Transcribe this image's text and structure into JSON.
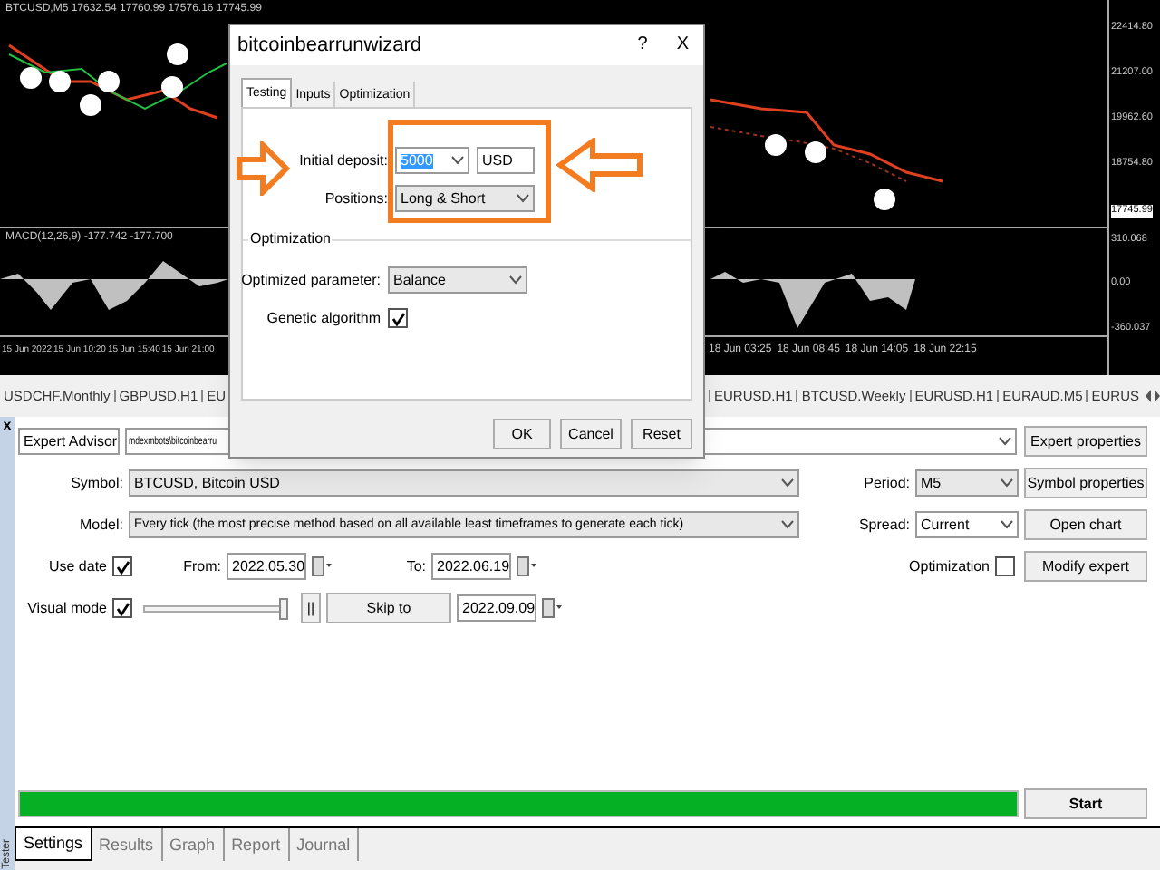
{
  "chart": {
    "header": "BTCUSD,M5 17632.54 17760.99 17576.16 17745.99",
    "macd_header": "MACD(12,26,9) -177.742 -177.700",
    "price_labels": [
      "22414.80",
      "21207.00",
      "19962.60",
      "18754.80"
    ],
    "current_price": "17745.99",
    "macd_labels": [
      "310.068",
      "0.00",
      "-360.037"
    ],
    "time_labels_left": [
      "15 Jun 2022",
      "15 Jun 10:20",
      "15 Jun 15:40",
      "15 Jun 21:00"
    ],
    "time_labels_right": [
      "18 Jun 03:25",
      "18 Jun 08:45",
      "18 Jun 14:05",
      "18 Jun 22:15"
    ]
  },
  "chart_tabs_left": [
    "USDCHF.Monthly",
    "GBPUSD.H1",
    "EU"
  ],
  "chart_tabs_right": [
    "EURUSD.H1",
    "BTCUSD.Weekly",
    "EURUSD.H1",
    "EURAUD.M5",
    "EURUS"
  ],
  "dialog": {
    "title": "bitcoinbearrunwizard",
    "help": "?",
    "close": "X",
    "tabs": [
      {
        "label": "Testing",
        "selected": true
      },
      {
        "label": "Inputs",
        "selected": false
      },
      {
        "label": "Optimization",
        "selected": false
      }
    ],
    "deposit_label": "Initial deposit:",
    "deposit": "5000",
    "currency": "USD",
    "positions_label": "Positions:",
    "positions": "Long & Short",
    "group_title": "Optimization",
    "param_label": "Optimized parameter:",
    "param": "Balance",
    "genetic_label": "Genetic algorithm",
    "genetic_checked": true,
    "buttons": [
      "OK",
      "Cancel",
      "Reset"
    ]
  },
  "tester": {
    "close": "x",
    "side_label": "Tester",
    "program_type": "Expert Advisor",
    "expert_path": "mdexmbots\\bitcoinbearru",
    "symbol_label": "Symbol:",
    "symbol": "BTCUSD, Bitcoin USD",
    "period_label": "Period:",
    "period": "M5",
    "model_label": "Model:",
    "model": "Every tick (the most precise method based on all available least timeframes to generate each tick)",
    "spread_label": "Spread:",
    "spread": "Current",
    "use_date_label": "Use date",
    "use_date_checked": true,
    "from_label": "From:",
    "from": "2022.05.30",
    "to_label": "To:",
    "to": "2022.06.19",
    "optimization_label": "Optimization",
    "optimization_checked": false,
    "visual_label": "Visual mode",
    "visual_checked": true,
    "speed": {
      "level": 1
    },
    "pause": "||",
    "skip_button": "Skip to",
    "skip_date": "2022.09.09",
    "buttons": [
      "Expert properties",
      "Symbol properties",
      "Open chart",
      "Modify expert"
    ],
    "start": "Start",
    "progress": {
      "level": 1
    },
    "tabs": [
      {
        "label": "Settings",
        "selected": true
      },
      {
        "label": "Results",
        "selected": false
      },
      {
        "label": "Graph",
        "selected": false
      },
      {
        "label": "Report",
        "selected": false
      },
      {
        "label": "Journal",
        "selected": false
      }
    ]
  }
}
